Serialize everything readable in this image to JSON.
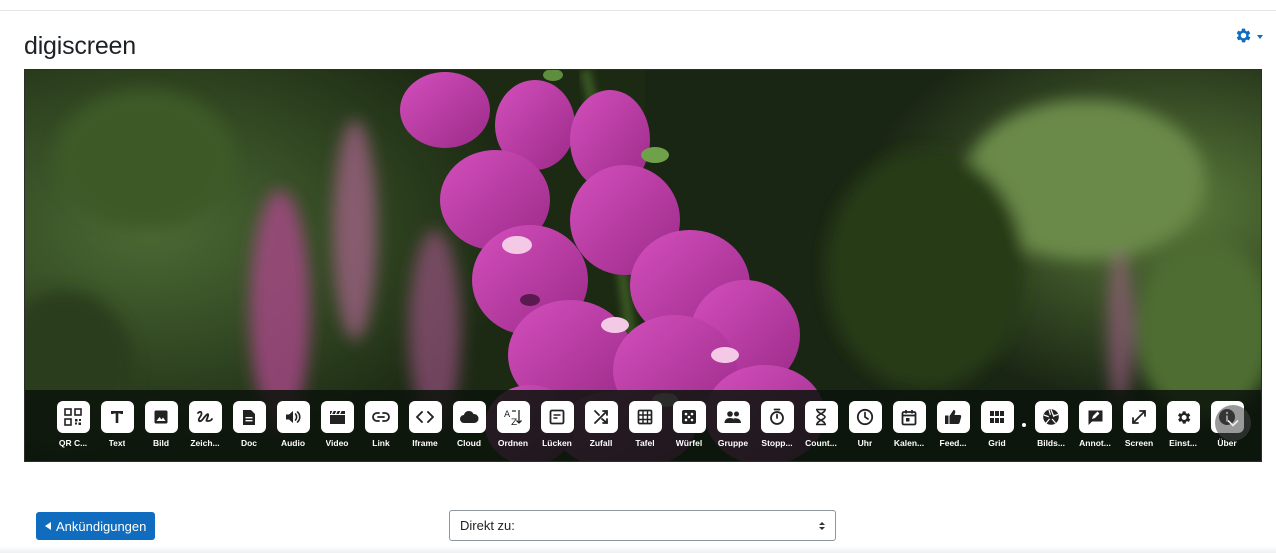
{
  "page": {
    "title": "digiscreen"
  },
  "settings_menu": {
    "icon": "gear-icon"
  },
  "stage": {
    "background": "foxglove-photo",
    "accent_flower": "#c23aa6",
    "foliage": "#2f4a1f"
  },
  "toolbar": {
    "items": [
      {
        "key": "qr",
        "label": "QR C...",
        "icon": "qr-code-icon"
      },
      {
        "key": "text",
        "label": "Text",
        "icon": "text-icon"
      },
      {
        "key": "bild",
        "label": "Bild",
        "icon": "image-icon"
      },
      {
        "key": "zeich",
        "label": "Zeich...",
        "icon": "draw-icon"
      },
      {
        "key": "doc",
        "label": "Doc",
        "icon": "document-icon"
      },
      {
        "key": "audio",
        "label": "Audio",
        "icon": "speaker-icon"
      },
      {
        "key": "video",
        "label": "Video",
        "icon": "clapperboard-icon"
      },
      {
        "key": "link",
        "label": "Link",
        "icon": "link-icon"
      },
      {
        "key": "iframe",
        "label": "Iframe",
        "icon": "code-brackets-icon"
      },
      {
        "key": "cloud",
        "label": "Cloud",
        "icon": "cloud-icon"
      },
      {
        "key": "ordnen",
        "label": "Ordnen",
        "icon": "sort-az-icon"
      },
      {
        "key": "luecken",
        "label": "Lücken",
        "icon": "fill-gaps-icon"
      },
      {
        "key": "zufall",
        "label": "Zufall",
        "icon": "shuffle-icon"
      },
      {
        "key": "tafel",
        "label": "Tafel",
        "icon": "table-grid-icon"
      },
      {
        "key": "wuerfel",
        "label": "Würfel",
        "icon": "dice-icon"
      },
      {
        "key": "gruppe",
        "label": "Gruppe",
        "icon": "group-icon"
      },
      {
        "key": "stopp",
        "label": "Stopp...",
        "icon": "stopwatch-icon"
      },
      {
        "key": "count",
        "label": "Count...",
        "icon": "hourglass-icon"
      },
      {
        "key": "uhr",
        "label": "Uhr",
        "icon": "clock-icon"
      },
      {
        "key": "kalen",
        "label": "Kalen...",
        "icon": "calendar-icon"
      },
      {
        "key": "feed",
        "label": "Feed...",
        "icon": "thumbs-up-icon"
      },
      {
        "key": "grid",
        "label": "Grid",
        "icon": "grid-icon"
      },
      {
        "key": "sep",
        "label": "",
        "icon": "dot-separator"
      },
      {
        "key": "bilds",
        "label": "Bilds...",
        "icon": "aperture-icon"
      },
      {
        "key": "annot",
        "label": "Annot...",
        "icon": "annotate-icon"
      },
      {
        "key": "screen",
        "label": "Screen",
        "icon": "fullscreen-icon"
      },
      {
        "key": "einst",
        "label": "Einst...",
        "icon": "gear-icon"
      },
      {
        "key": "ueber",
        "label": "Über",
        "icon": "info-icon"
      }
    ],
    "scroll_icon": "chevron-down-icon"
  },
  "footer": {
    "announcements_label": "Ankündigungen",
    "jump_label": "Direkt zu:"
  },
  "colors": {
    "primary": "#0f6cbf",
    "toolbar_bg": "#0c140c"
  }
}
